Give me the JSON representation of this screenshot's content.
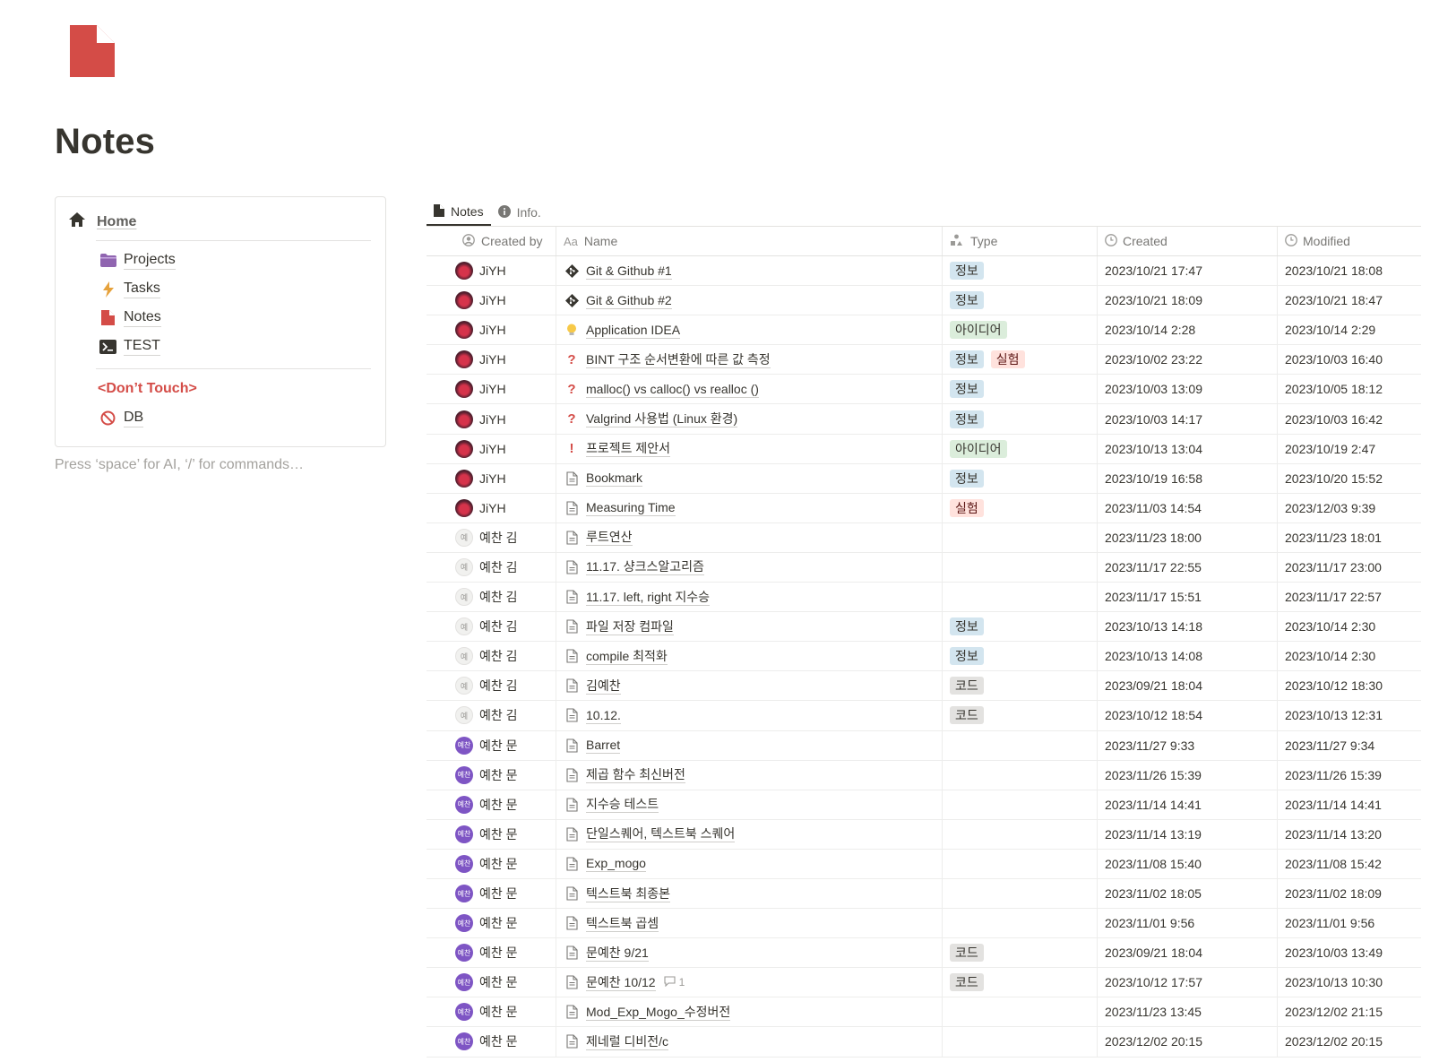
{
  "page": {
    "title": "Notes",
    "icon": "page-icon",
    "accent": "#d44c47"
  },
  "nav": {
    "home": "Home",
    "items": [
      {
        "label": "Projects",
        "icon": "folder-icon"
      },
      {
        "label": "Tasks",
        "icon": "lightning-icon"
      },
      {
        "label": "Notes",
        "icon": "page-icon"
      },
      {
        "label": "TEST",
        "icon": "terminal-icon"
      }
    ],
    "section_label": "<Don’t Touch>",
    "db_label": "DB"
  },
  "hint": "Press ‘space’ for AI, ‘/’ for commands…",
  "tabs": [
    {
      "label": "Notes",
      "icon": "page-icon",
      "active": true
    },
    {
      "label": "Info.",
      "icon": "info-icon",
      "active": false
    }
  ],
  "columns": {
    "created_by": "Created by",
    "name": "Name",
    "type": "Type",
    "created": "Created",
    "modified": "Modified"
  },
  "rows": [
    {
      "by": "JiYH",
      "avatar": "red",
      "icon": "git",
      "name": "Git & Github #1",
      "tags": [
        "정보"
      ],
      "created": "2023/10/21 17:47",
      "modified": "2023/10/21 18:08"
    },
    {
      "by": "JiYH",
      "avatar": "red",
      "icon": "git",
      "name": "Git & Github #2",
      "tags": [
        "정보"
      ],
      "created": "2023/10/21 18:09",
      "modified": "2023/10/21 18:47"
    },
    {
      "by": "JiYH",
      "avatar": "red",
      "icon": "bulb",
      "name": "Application IDEA",
      "tags": [
        "아이디어"
      ],
      "created": "2023/10/14 2:28",
      "modified": "2023/10/14 2:29"
    },
    {
      "by": "JiYH",
      "avatar": "red",
      "icon": "question",
      "name": "BINT 구조 순서변환에 따른 값 측정",
      "tags": [
        "정보",
        "실험"
      ],
      "created": "2023/10/02 23:22",
      "modified": "2023/10/03 16:40"
    },
    {
      "by": "JiYH",
      "avatar": "red",
      "icon": "question",
      "name": "malloc() vs calloc() vs realloc ()",
      "tags": [
        "정보"
      ],
      "created": "2023/10/03 13:09",
      "modified": "2023/10/05 18:12"
    },
    {
      "by": "JiYH",
      "avatar": "red",
      "icon": "question",
      "name": "Valgrind 사용법 (Linux 환경)",
      "tags": [
        "정보"
      ],
      "created": "2023/10/03 14:17",
      "modified": "2023/10/03 16:42"
    },
    {
      "by": "JiYH",
      "avatar": "red",
      "icon": "exclaim",
      "name": "프로젝트 제안서",
      "tags": [
        "아이디어"
      ],
      "created": "2023/10/13 13:04",
      "modified": "2023/10/19 2:47"
    },
    {
      "by": "JiYH",
      "avatar": "red",
      "icon": "doc",
      "name": "Bookmark",
      "tags": [
        "정보"
      ],
      "created": "2023/10/19 16:58",
      "modified": "2023/10/20 15:52"
    },
    {
      "by": "JiYH",
      "avatar": "red",
      "icon": "doc",
      "name": "Measuring Time",
      "tags": [
        "실험"
      ],
      "created": "2023/11/03 14:54",
      "modified": "2023/12/03 9:39"
    },
    {
      "by": "예찬 김",
      "avatar": "gray",
      "avatar_text": "예",
      "icon": "doc",
      "name": "루트연산",
      "tags": [],
      "created": "2023/11/23 18:00",
      "modified": "2023/11/23 18:01"
    },
    {
      "by": "예찬 김",
      "avatar": "gray",
      "avatar_text": "예",
      "icon": "doc",
      "name": "11.17. 샹크스알고리즘",
      "tags": [],
      "created": "2023/11/17 22:55",
      "modified": "2023/11/17 23:00"
    },
    {
      "by": "예찬 김",
      "avatar": "gray",
      "avatar_text": "예",
      "icon": "doc",
      "name": "11.17. left, right 지수승",
      "tags": [],
      "created": "2023/11/17 15:51",
      "modified": "2023/11/17 22:57"
    },
    {
      "by": "예찬 김",
      "avatar": "gray",
      "avatar_text": "예",
      "icon": "doc",
      "name": " 파일 저장 컴파일",
      "tags": [
        "정보"
      ],
      "created": "2023/10/13 14:18",
      "modified": "2023/10/14 2:30"
    },
    {
      "by": "예찬 김",
      "avatar": "gray",
      "avatar_text": "예",
      "icon": "doc",
      "name": "compile 최적화",
      "tags": [
        "정보"
      ],
      "created": "2023/10/13 14:08",
      "modified": "2023/10/14 2:30"
    },
    {
      "by": "예찬 김",
      "avatar": "gray",
      "avatar_text": "예",
      "icon": "doc",
      "name": "김예찬",
      "tags": [
        "코드"
      ],
      "created": "2023/09/21 18:04",
      "modified": "2023/10/12 18:30"
    },
    {
      "by": "예찬 김",
      "avatar": "gray",
      "avatar_text": "예",
      "icon": "doc",
      "name": "10.12.",
      "tags": [
        "코드"
      ],
      "created": "2023/10/12 18:54",
      "modified": "2023/10/13 12:31"
    },
    {
      "by": "예찬 문",
      "avatar": "purple",
      "avatar_text": "예찬",
      "icon": "doc",
      "name": "Barret",
      "tags": [],
      "created": "2023/11/27 9:33",
      "modified": "2023/11/27 9:34"
    },
    {
      "by": "예찬 문",
      "avatar": "purple",
      "avatar_text": "예찬",
      "icon": "doc",
      "name": "제곱 함수 최신버전",
      "tags": [],
      "created": "2023/11/26 15:39",
      "modified": "2023/11/26 15:39"
    },
    {
      "by": "예찬 문",
      "avatar": "purple",
      "avatar_text": "예찬",
      "icon": "doc",
      "name": "지수승 테스트",
      "tags": [],
      "created": "2023/11/14 14:41",
      "modified": "2023/11/14 14:41"
    },
    {
      "by": "예찬 문",
      "avatar": "purple",
      "avatar_text": "예찬",
      "icon": "doc",
      "name": "단일스퀘어, 텍스트북 스퀘어",
      "tags": [],
      "created": "2023/11/14 13:19",
      "modified": "2023/11/14 13:20"
    },
    {
      "by": "예찬 문",
      "avatar": "purple",
      "avatar_text": "예찬",
      "icon": "doc",
      "name": "Exp_mogo",
      "tags": [],
      "created": "2023/11/08 15:40",
      "modified": "2023/11/08 15:42"
    },
    {
      "by": "예찬 문",
      "avatar": "purple",
      "avatar_text": "예찬",
      "icon": "doc",
      "name": "텍스트북 최종본",
      "tags": [],
      "created": "2023/11/02 18:05",
      "modified": "2023/11/02 18:09"
    },
    {
      "by": "예찬 문",
      "avatar": "purple",
      "avatar_text": "예찬",
      "icon": "doc",
      "name": "텍스트북 곱셈",
      "tags": [],
      "created": "2023/11/01 9:56",
      "modified": "2023/11/01 9:56"
    },
    {
      "by": "예찬 문",
      "avatar": "purple",
      "avatar_text": "예찬",
      "icon": "doc",
      "name": "문예찬 9/21",
      "tags": [
        "코드"
      ],
      "created": "2023/09/21 18:04",
      "modified": "2023/10/03 13:49"
    },
    {
      "by": "예찬 문",
      "avatar": "purple",
      "avatar_text": "예찬",
      "icon": "doc",
      "name": "문예찬 10/12",
      "comments": "1",
      "tags": [
        "코드"
      ],
      "created": "2023/10/12 17:57",
      "modified": "2023/10/13 10:30"
    },
    {
      "by": "예찬 문",
      "avatar": "purple",
      "avatar_text": "예찬",
      "icon": "doc",
      "name": "Mod_Exp_Mogo_수정버전",
      "tags": [],
      "created": "2023/11/23 13:45",
      "modified": "2023/12/02 21:15"
    },
    {
      "by": "예찬 문",
      "avatar": "purple",
      "avatar_text": "예찬",
      "icon": "doc",
      "name": "제네럴 디비전/c",
      "tags": [],
      "created": "2023/12/02 20:15",
      "modified": "2023/12/02 20:15"
    }
  ]
}
